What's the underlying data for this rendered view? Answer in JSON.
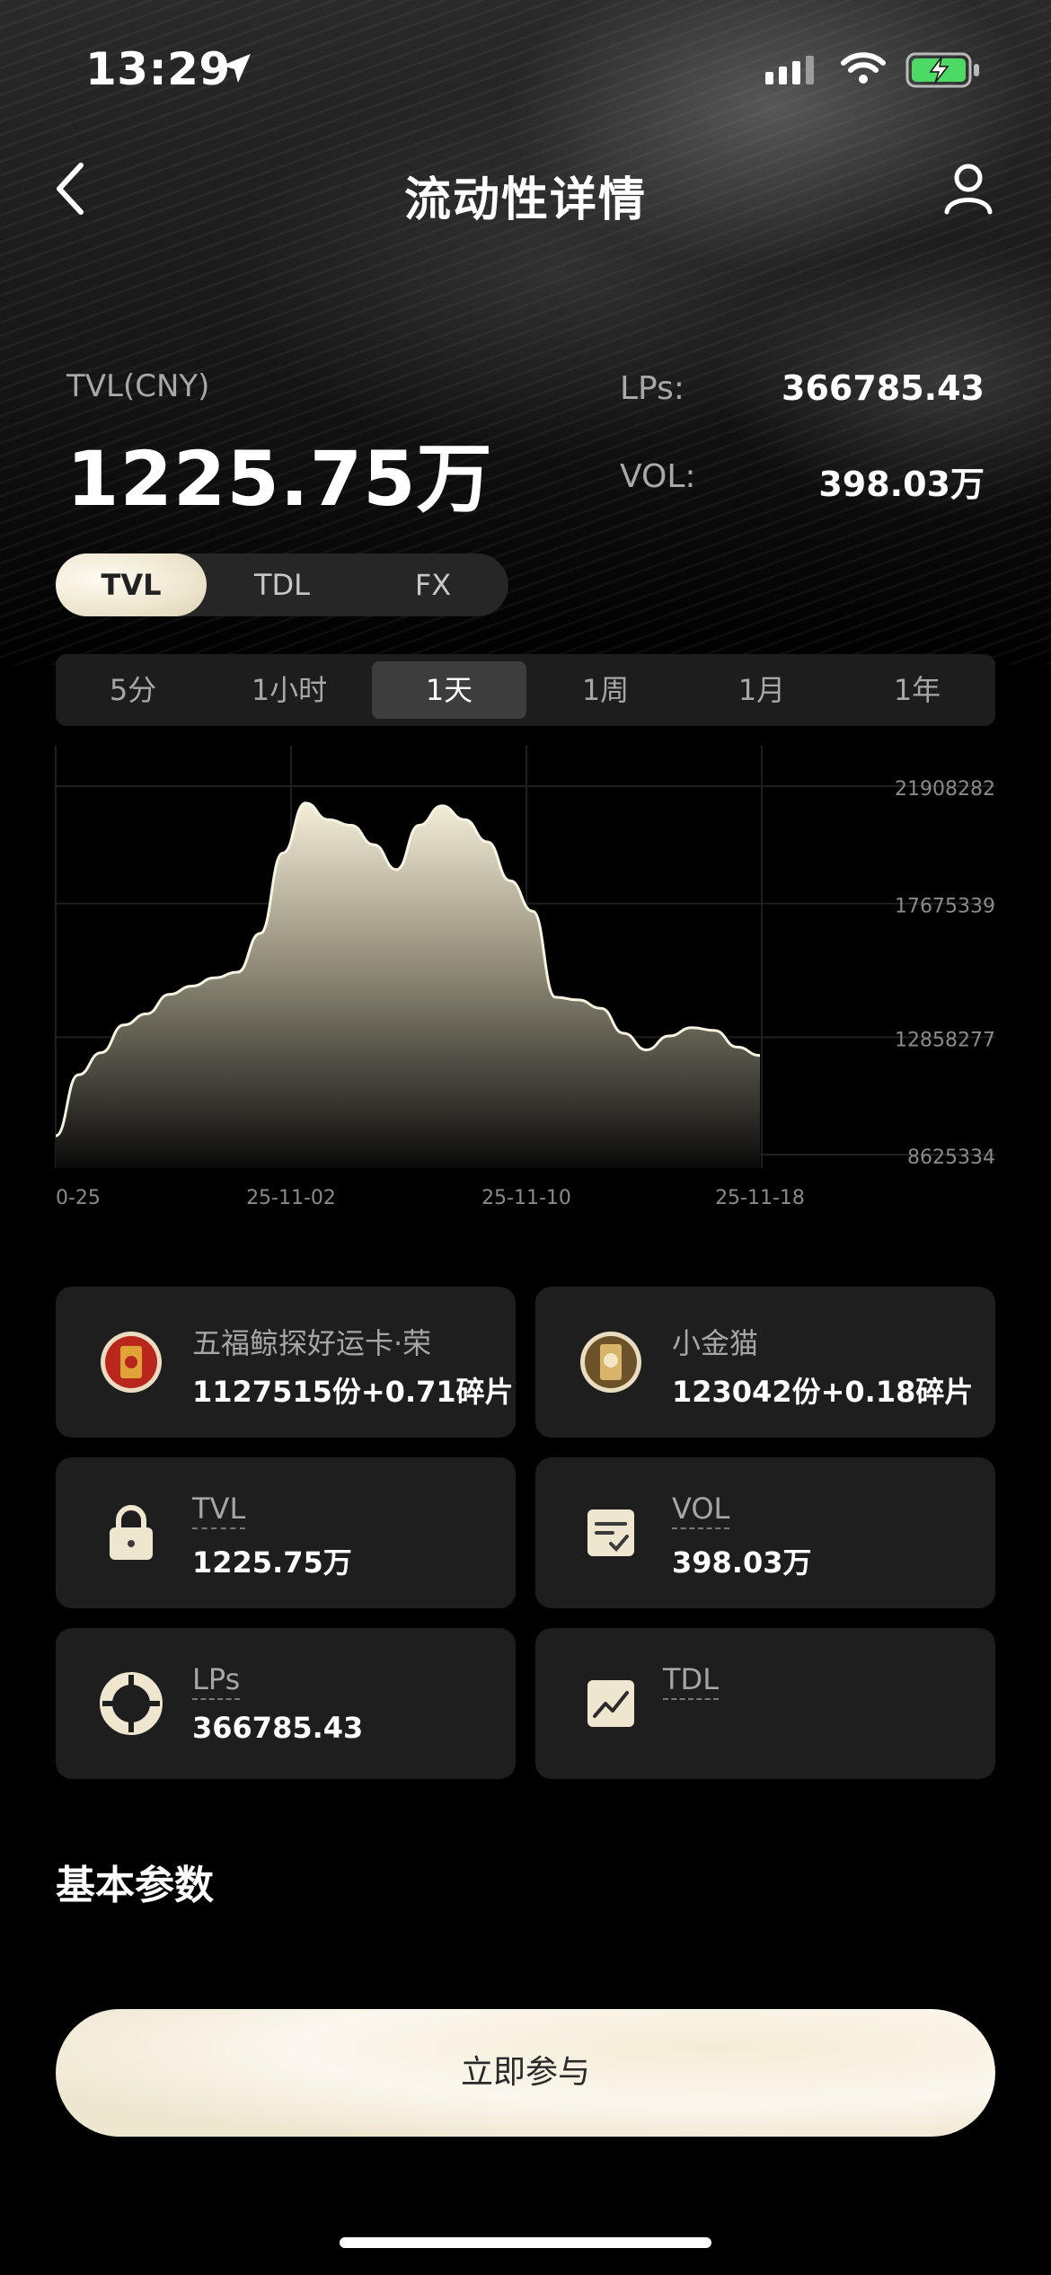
{
  "status_bar": {
    "time": "13:29"
  },
  "nav": {
    "title": "流动性详情"
  },
  "stats": {
    "tvl_label": "TVL(CNY)",
    "tvl_value": "1225.75万",
    "lps_label": "LPs:",
    "lps_value": "366785.43",
    "vol_label": "VOL:",
    "vol_value": "398.03万"
  },
  "metric_tabs": [
    {
      "label": "TVL",
      "active": true
    },
    {
      "label": "TDL",
      "active": false
    },
    {
      "label": "FX",
      "active": false
    }
  ],
  "range_tabs": [
    {
      "label": "5分",
      "active": false
    },
    {
      "label": "1小时",
      "active": false
    },
    {
      "label": "1天",
      "active": true
    },
    {
      "label": "1周",
      "active": false
    },
    {
      "label": "1月",
      "active": false
    },
    {
      "label": "1年",
      "active": false
    }
  ],
  "chart_data": {
    "type": "area",
    "x_tick_labels": [
      "0-25",
      "25-11-02",
      "25-11-10",
      "25-11-18"
    ],
    "y_tick_labels": [
      "21908282",
      "17675339",
      "12858277",
      "8625334"
    ],
    "ylim": [
      8625334,
      21908282
    ],
    "grid": true,
    "series": [
      {
        "values": [
          9300000,
          11500000,
          12300000,
          13300000,
          13700000,
          14400000,
          14700000,
          15000000,
          15200000,
          16600000,
          19500000,
          21300000,
          20700000,
          20500000,
          19800000,
          18900000,
          20500000,
          21200000,
          20700000,
          19900000,
          18500000,
          17400000,
          14300000,
          14200000,
          13900000,
          13000000,
          12400000,
          12900000,
          13200000,
          13100000,
          12500000,
          12200000
        ]
      }
    ]
  },
  "cards": [
    {
      "title": "五福鲸探好运卡·荣",
      "value": "1127515份+0.71碎片",
      "icon": "red-card-icon"
    },
    {
      "title": "小金猫",
      "value": "123042份+0.18碎片",
      "icon": "gold-cat-icon"
    },
    {
      "title": "TVL",
      "value": "1225.75万",
      "icon": "lock-icon"
    },
    {
      "title": "VOL",
      "value": "398.03万",
      "icon": "checklist-icon"
    },
    {
      "title": "LPs",
      "value": "366785.43",
      "icon": "lifebuoy-icon"
    },
    {
      "title": "TDL",
      "value": "",
      "icon": "trend-chart-icon"
    }
  ],
  "section": {
    "title": "基本参数"
  },
  "cta": {
    "label": "立即参与"
  },
  "colors": {
    "accent": "#f3ecda",
    "background": "#000000",
    "card": "#1e1e1e"
  }
}
